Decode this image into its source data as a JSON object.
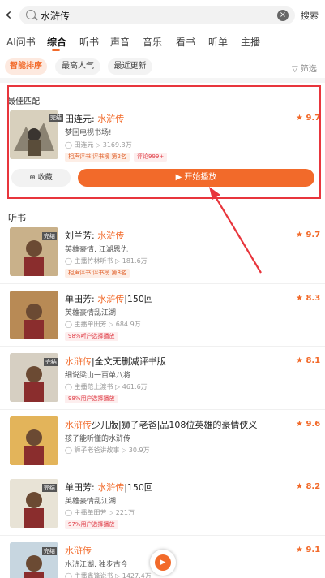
{
  "search": {
    "query": "水浒传",
    "search_label": "搜索",
    "clear_glyph": "×"
  },
  "tabs": [
    "AI问书",
    "综合",
    "听书",
    "声音",
    "音乐",
    "看书",
    "听单",
    "主播"
  ],
  "filters": {
    "chips": [
      "智能排序",
      "最高人气",
      "最近更新"
    ],
    "filter_label": "筛选"
  },
  "best": {
    "section_label": "最佳匹配",
    "title_prefix": "田连元: ",
    "title_highlight": "水浒传",
    "desc": "梦回电视书场!",
    "author": "田连元",
    "plays": "3169.3万",
    "tag1": "相声评书 评书榜 第2名",
    "tag2": "评论999+",
    "rating": "★ 9.7",
    "badge": "完结",
    "collect_label": "收藏",
    "play_label": "▶ 开始播放"
  },
  "section_title": "听书",
  "results": [
    {
      "prefix": "刘兰芳: ",
      "hl": "水浒传",
      "suffix": "",
      "desc": "英雄豪情, 江湖恩仇",
      "author": "主播竹林听书",
      "plays": "181.6万",
      "tag": "相声评书 评书榜 第8名",
      "tag_style": "orange",
      "rating": "★ 9.7",
      "badge": "完结"
    },
    {
      "prefix": "单田芳: ",
      "hl": "水浒传",
      "suffix": "|150回",
      "desc": "英雄豪情乱江湖",
      "author": "主播单田芳",
      "plays": "684.9万",
      "tag": "98%听户选择播放",
      "tag_style": "red",
      "rating": "★ 8.3",
      "badge": ""
    },
    {
      "prefix": "",
      "hl": "水浒传",
      "suffix": "|全文无删减评书版",
      "desc": "细说梁山一百单八将",
      "author": "主播范上渡书",
      "plays": "461.6万",
      "tag": "98%用户选择播放",
      "tag_style": "red",
      "rating": "★ 8.1",
      "badge": "完结"
    },
    {
      "prefix": "",
      "hl": "水浒传",
      "suffix": "少儿版|狮子老爸|品108位英雄的豪情侠义",
      "desc": "孩子能听懂的水浒传",
      "author": "狮子老爸讲故事",
      "plays": "30.9万",
      "tag": "",
      "tag_style": "",
      "rating": "★ 9.6",
      "badge": ""
    },
    {
      "prefix": "单田芳: ",
      "hl": "水浒传",
      "suffix": "|150回",
      "desc": "英雄豪情乱江湖",
      "author": "主播单田芳",
      "plays": "221万",
      "tag": "97%用户选择播放",
      "tag_style": "red",
      "rating": "★ 8.2",
      "badge": "完结"
    },
    {
      "prefix": "",
      "hl": "水浒传",
      "suffix": "",
      "desc": "水浒江湖, 独步古今",
      "author": "主播鑫锋说书",
      "plays": "1427.4万",
      "tag": "",
      "tag_style": "",
      "rating": "★ 9.1",
      "badge": "完结"
    }
  ],
  "colors": {
    "accent": "#f26a2a",
    "highlight_box": "#e8353c"
  }
}
